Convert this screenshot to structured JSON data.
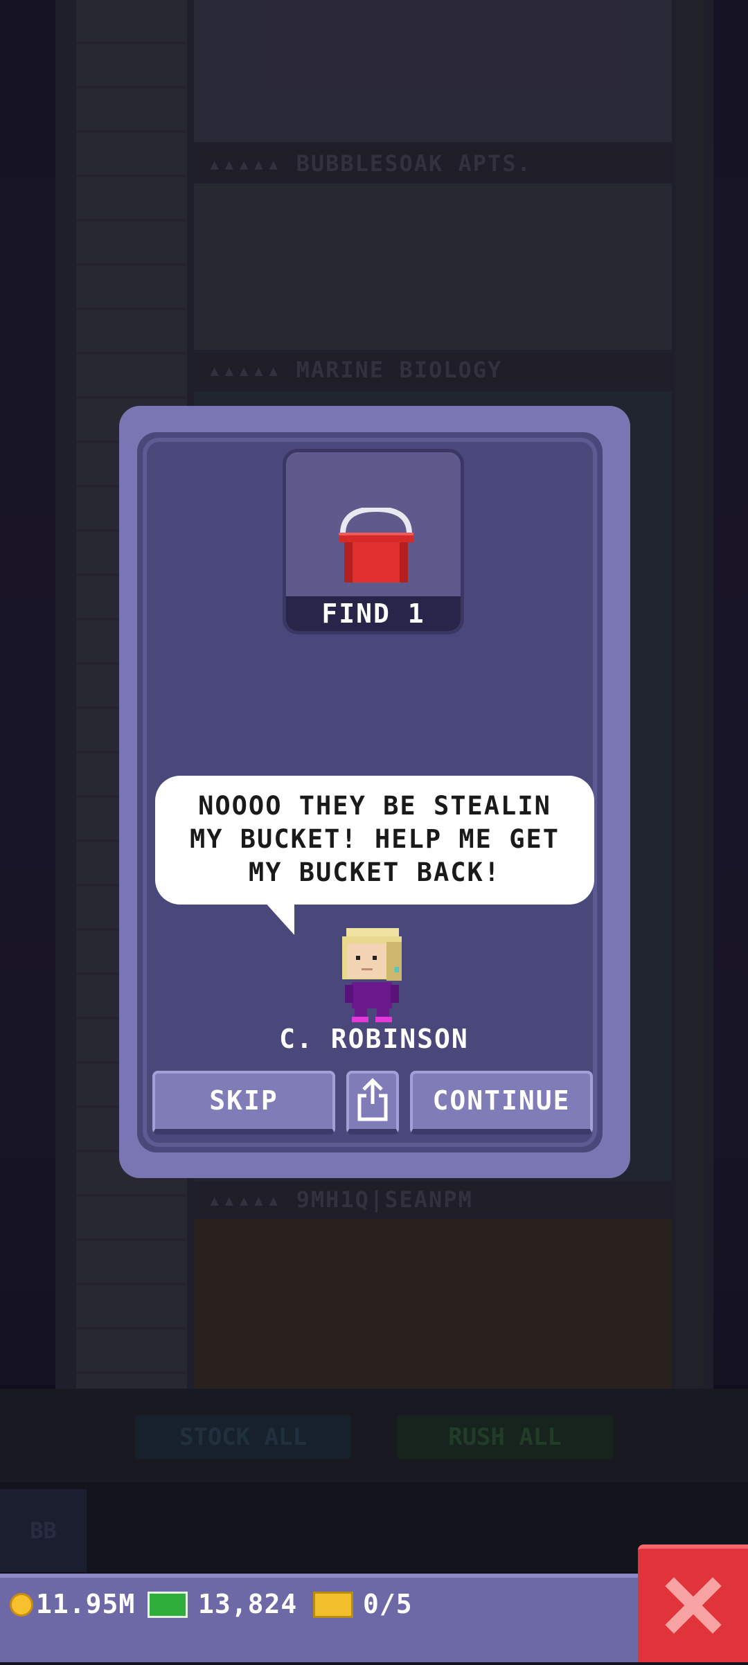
{
  "tower": {
    "floor_labels": [
      "BUBBLESOAK APTS.",
      "MARINE BIOLOGY",
      "9MH1Q|SEANPM"
    ],
    "stock_all_label": "STOCK ALL",
    "rush_all_label": "RUSH ALL",
    "bb_label": "BB"
  },
  "dialog": {
    "item_icon": "red-bucket-icon",
    "find_label": "FIND 1",
    "speech_lines": [
      "NOOOO THEY BE STEALIN",
      "MY BUCKET! HELP ME GET",
      "MY BUCKET BACK!"
    ],
    "npc_name": "C. ROBINSON",
    "skip_label": "SKIP",
    "share_icon": "share-icon",
    "continue_label": "CONTINUE"
  },
  "status": {
    "coins": "11.95M",
    "bux": "13,824",
    "tickets": "0/5"
  },
  "colors": {
    "dialog_frame": "#7a76b4",
    "dialog_inner": "#4a477a",
    "button": "#7f7cb8",
    "close_button": "#e0333a"
  }
}
